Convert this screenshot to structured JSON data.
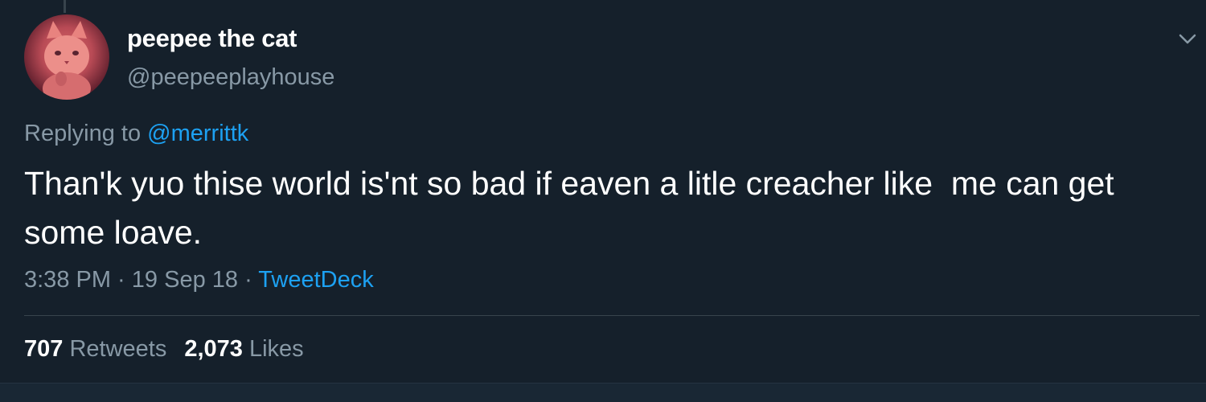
{
  "user": {
    "display_name": "peepee the cat",
    "handle": "@peepeeplayhouse",
    "avatar_icon": "cat-avatar"
  },
  "reply": {
    "prefix": "Replying to ",
    "to": "@merrittk"
  },
  "tweet": {
    "text": "Than'k yuo thise world is'nt so bad if eaven a litle creacher like  me can get some loave."
  },
  "meta": {
    "time": "3:38 PM",
    "sep1": " · ",
    "date": "19 Sep 18",
    "sep2": " · ",
    "source": "TweetDeck"
  },
  "stats": {
    "retweets_count": "707",
    "retweets_label": " Retweets",
    "likes_count": "2,073",
    "likes_label": " Likes"
  },
  "colors": {
    "background": "#15202b",
    "link": "#1da1f2",
    "secondary_text": "#8899a6",
    "primary_text": "#ffffff"
  }
}
